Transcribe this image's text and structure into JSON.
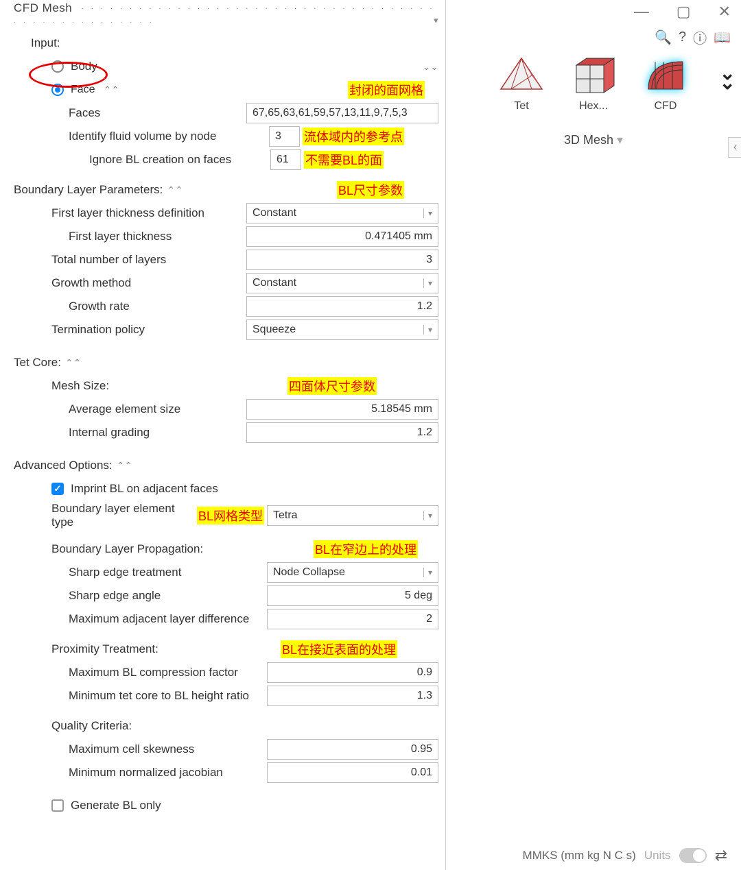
{
  "panel_title": "CFD Mesh",
  "input_section": "Input:",
  "radio_body": "Body",
  "radio_face": "Face",
  "faces_label": "Faces",
  "faces_value": "67,65,63,61,59,57,13,11,9,7,5,3",
  "identify_fluid_label": "Identify fluid volume by node",
  "identify_fluid_value": "3",
  "ignore_bl_label": "Ignore BL creation on faces",
  "ignore_bl_value": "61",
  "bl_params_section": "Boundary Layer Parameters:",
  "first_layer_def_label": "First layer thickness definition",
  "first_layer_def_value": "Constant",
  "first_layer_thickness_label": "First layer thickness",
  "first_layer_thickness_value": "0.471405 mm",
  "total_layers_label": "Total number of layers",
  "total_layers_value": "3",
  "growth_method_label": "Growth method",
  "growth_method_value": "Constant",
  "growth_rate_label": "Growth rate",
  "growth_rate_value": "1.2",
  "termination_label": "Termination policy",
  "termination_value": "Squeeze",
  "tet_core_section": "Tet Core:",
  "mesh_size_label": "Mesh Size:",
  "avg_elem_label": "Average element size",
  "avg_elem_value": "5.18545 mm",
  "internal_grading_label": "Internal grading",
  "internal_grading_value": "1.2",
  "advanced_section": "Advanced Options:",
  "imprint_bl_label": "Imprint BL on adjacent faces",
  "bl_elem_type_label": "Boundary layer element type",
  "bl_elem_type_value": "Tetra",
  "bl_propagation_label": "Boundary Layer Propagation:",
  "sharp_edge_treat_label": "Sharp edge treatment",
  "sharp_edge_treat_value": "Node Collapse",
  "sharp_edge_angle_label": "Sharp edge angle",
  "sharp_edge_angle_value": "5 deg",
  "max_adj_layer_label": "Maximum adjacent layer difference",
  "max_adj_layer_value": "2",
  "proximity_label": "Proximity Treatment:",
  "max_bl_comp_label": "Maximum BL compression factor",
  "max_bl_comp_value": "0.9",
  "min_tet_ratio_label": "Minimum tet core to BL height ratio",
  "min_tet_ratio_value": "1.3",
  "quality_label": "Quality Criteria:",
  "max_skew_label": "Maximum cell skewness",
  "max_skew_value": "0.95",
  "min_jacobian_label": "Minimum normalized jacobian",
  "min_jacobian_value": "0.01",
  "generate_bl_label": "Generate BL only",
  "annotations": {
    "closed_face_mesh": "封闭的面网格",
    "fluid_ref_point": "流体域内的参考点",
    "no_bl_faces": "不需要BL的面",
    "bl_size_params": "BL尺寸参数",
    "tet_size_params": "四面体尺寸参数",
    "bl_mesh_type": "BL网格类型",
    "bl_narrow_edge": "BL在窄边上的处理",
    "bl_near_surface": "BL在接近表面的处理"
  },
  "right": {
    "tet_label": "Tet",
    "hex_label": "Hex...",
    "cfd_label": "CFD",
    "category": "3D Mesh",
    "units_text": "MMKS (mm kg N C s)",
    "units_label": "Units"
  }
}
